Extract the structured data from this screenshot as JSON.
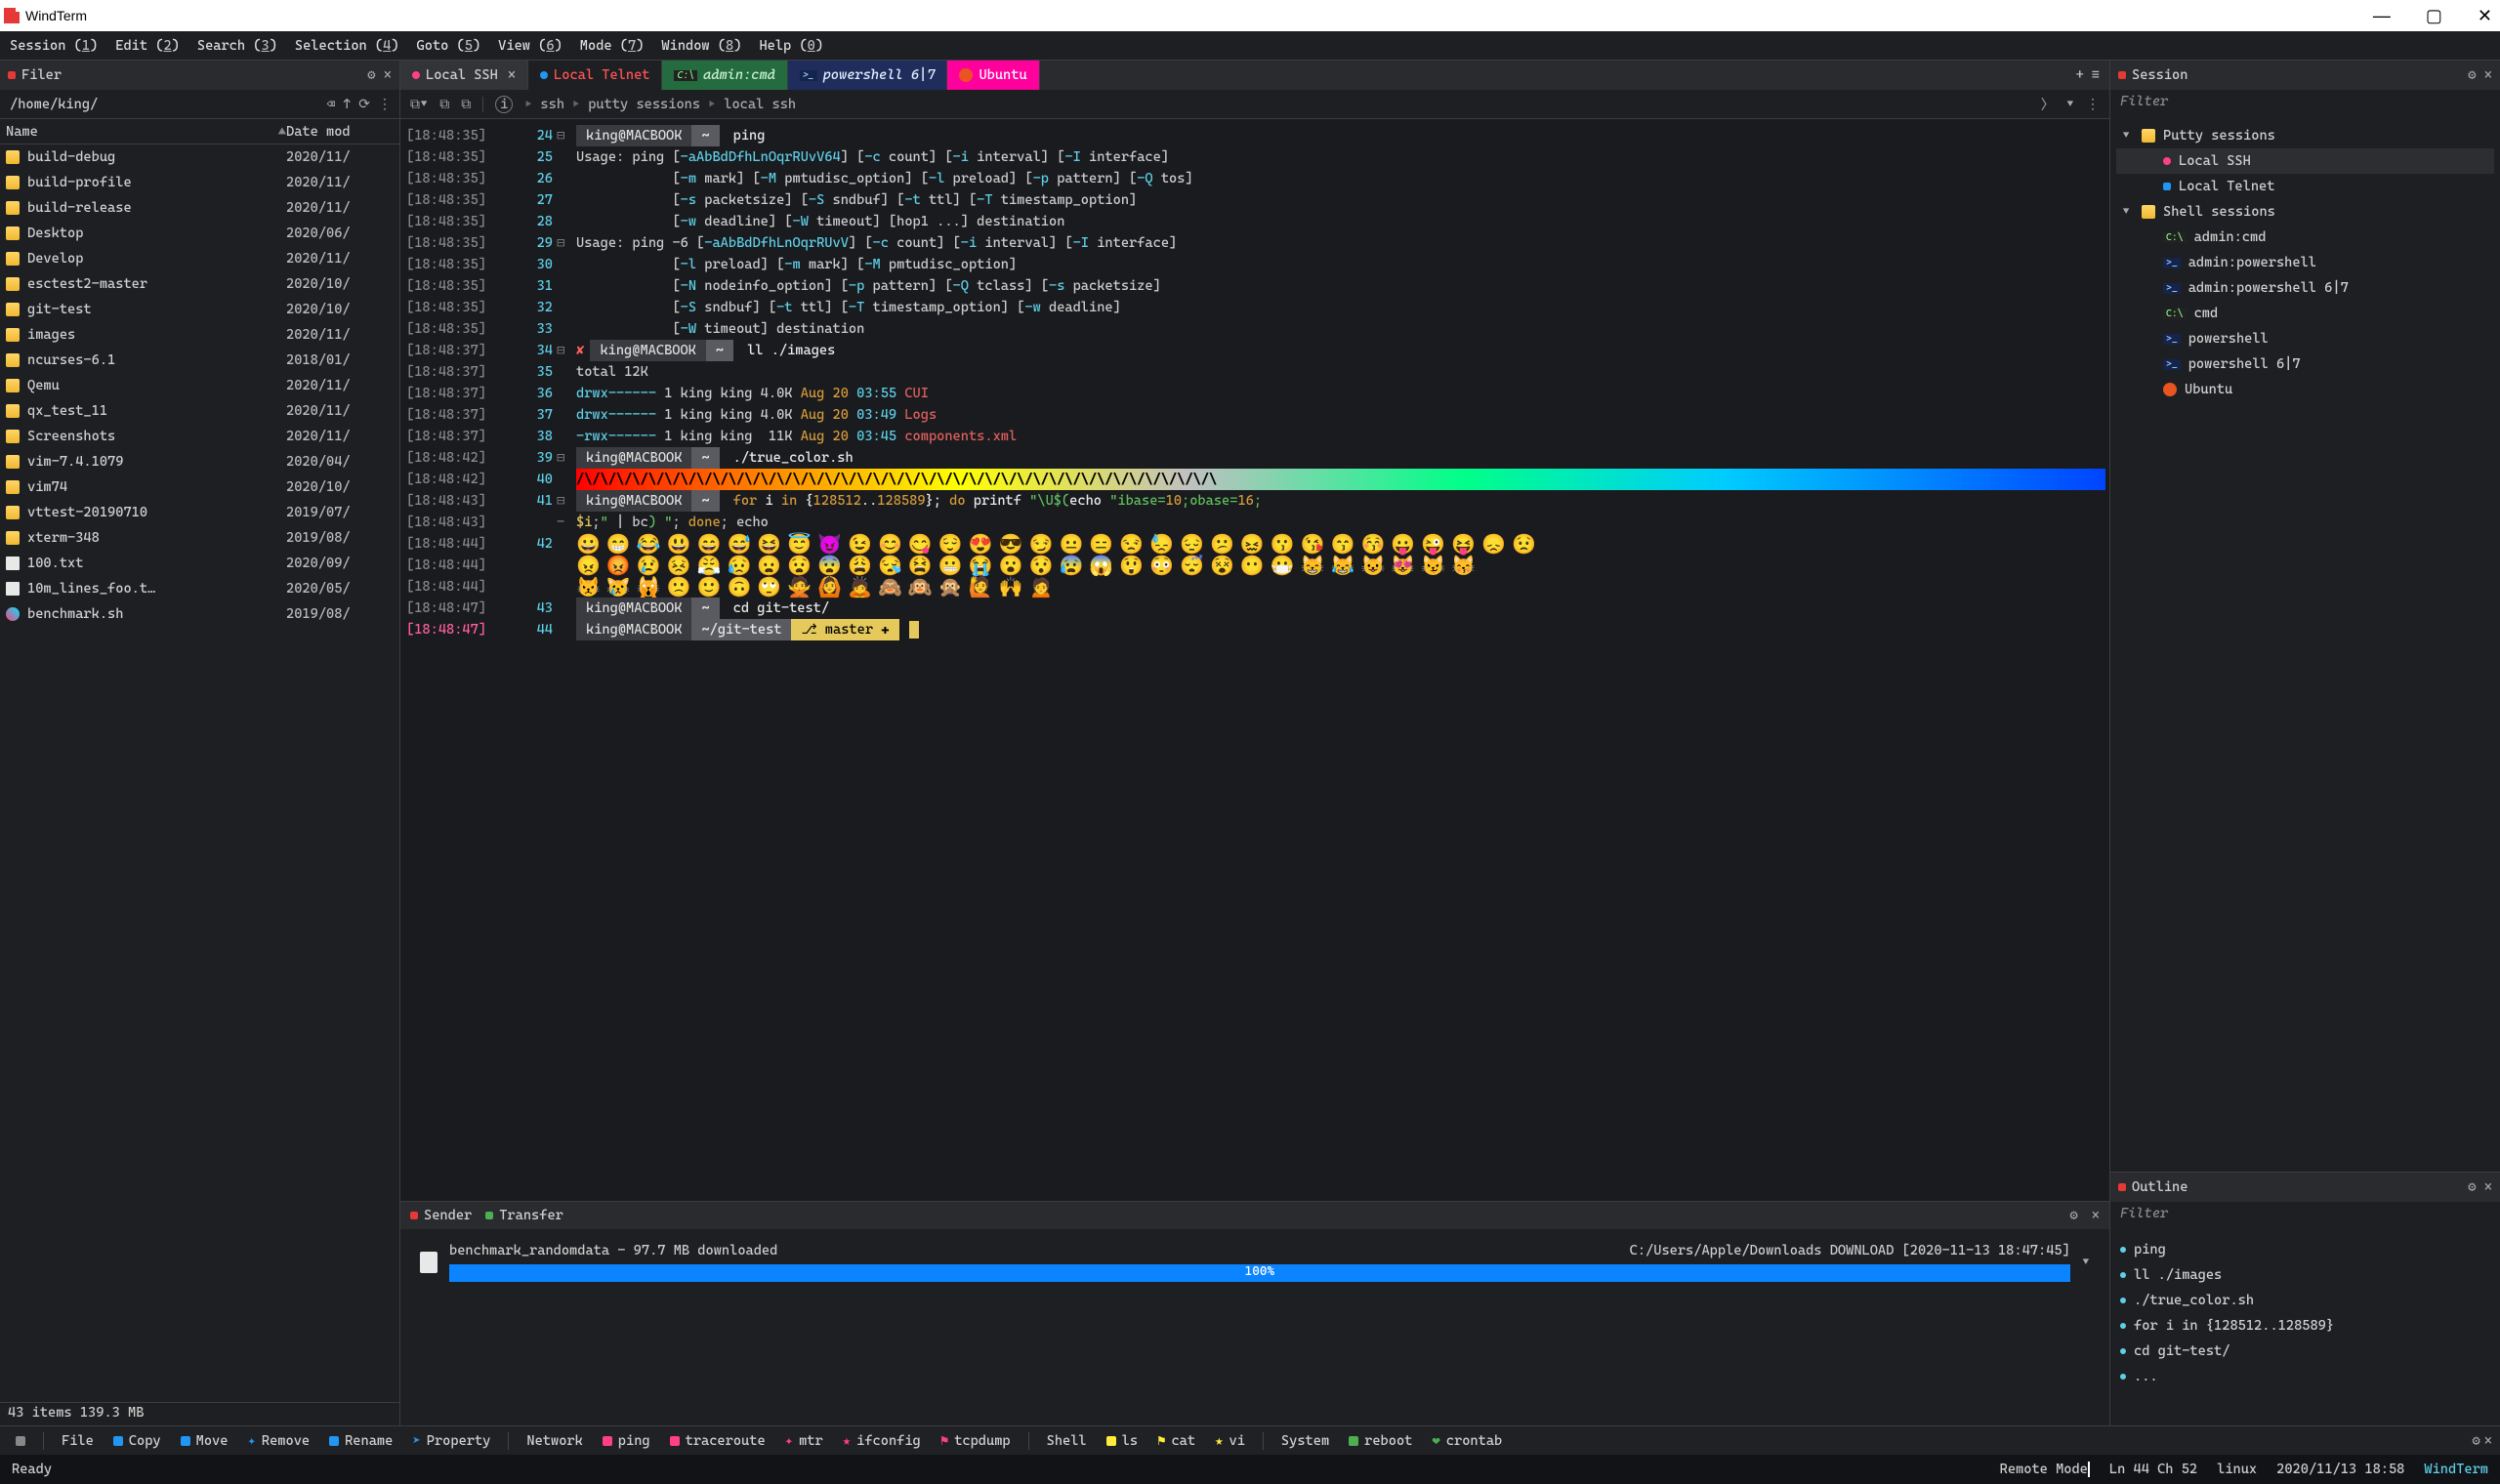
{
  "app": {
    "title": "WindTerm"
  },
  "menu": [
    {
      "label": "Session",
      "key": "1"
    },
    {
      "label": "Edit",
      "key": "2"
    },
    {
      "label": "Search",
      "key": "3"
    },
    {
      "label": "Selection",
      "key": "4"
    },
    {
      "label": "Goto",
      "key": "5"
    },
    {
      "label": "View",
      "key": "6"
    },
    {
      "label": "Mode",
      "key": "7"
    },
    {
      "label": "Window",
      "key": "8"
    },
    {
      "label": "Help",
      "key": "0"
    }
  ],
  "filer": {
    "title": "Filer",
    "path": "/home/king/",
    "columns": [
      "Name",
      "Date mod"
    ],
    "rows": [
      {
        "icon": "folder",
        "name": "build-debug",
        "date": "2020/11/"
      },
      {
        "icon": "folder",
        "name": "build-profile",
        "date": "2020/11/"
      },
      {
        "icon": "folder",
        "name": "build-release",
        "date": "2020/11/"
      },
      {
        "icon": "folder",
        "name": "Desktop",
        "date": "2020/06/"
      },
      {
        "icon": "folder",
        "name": "Develop",
        "date": "2020/11/"
      },
      {
        "icon": "folder",
        "name": "esctest2-master",
        "date": "2020/10/"
      },
      {
        "icon": "folder",
        "name": "git-test",
        "date": "2020/10/"
      },
      {
        "icon": "folder",
        "name": "images",
        "date": "2020/11/"
      },
      {
        "icon": "folder",
        "name": "ncurses-6.1",
        "date": "2018/01/"
      },
      {
        "icon": "folder",
        "name": "Qemu",
        "date": "2020/11/"
      },
      {
        "icon": "folder",
        "name": "qx_test_11",
        "date": "2020/11/"
      },
      {
        "icon": "folder",
        "name": "Screenshots",
        "date": "2020/11/"
      },
      {
        "icon": "folder",
        "name": "vim-7.4.1079",
        "date": "2020/04/"
      },
      {
        "icon": "folder",
        "name": "vim74",
        "date": "2020/10/"
      },
      {
        "icon": "folder",
        "name": "vttest-20190710",
        "date": "2019/07/"
      },
      {
        "icon": "folder",
        "name": "xterm-348",
        "date": "2019/08/"
      },
      {
        "icon": "file",
        "name": "100.txt",
        "date": "2020/09/"
      },
      {
        "icon": "file",
        "name": "10m_lines_foo.t…",
        "date": "2020/05/"
      },
      {
        "icon": "shell",
        "name": "benchmark.sh",
        "date": "2019/08/"
      }
    ],
    "status": "43 items 139.3 MB"
  },
  "tabs": [
    {
      "kind": "local",
      "label": "Local SSH",
      "active": true,
      "closable": true
    },
    {
      "kind": "telnet",
      "label": "Local Telnet"
    },
    {
      "kind": "cmd",
      "label": "admin:cmd"
    },
    {
      "kind": "ps",
      "label": "powershell 6|7"
    },
    {
      "kind": "ubuntu",
      "label": "Ubuntu"
    }
  ],
  "breadcrumb": [
    "ssh",
    "putty sessions",
    "local ssh"
  ],
  "term": {
    "timestamps": [
      "[18:48:35]",
      "[18:48:35]",
      "[18:48:35]",
      "[18:48:35]",
      "[18:48:35]",
      "[18:48:35]",
      "[18:48:35]",
      "[18:48:35]",
      "[18:48:35]",
      "[18:48:35]",
      "[18:48:37]",
      "[18:48:37]",
      "[18:48:37]",
      "[18:48:37]",
      "[18:48:37]",
      "[18:48:42]",
      "[18:48:42]",
      "[18:48:43]",
      "[18:48:43]",
      "[18:48:44]",
      "[18:48:44]",
      "[18:48:44]",
      "[18:48:47]",
      "[18:48:47]"
    ],
    "linenos": [
      "24",
      "25",
      "26",
      "27",
      "28",
      "29",
      "30",
      "31",
      "32",
      "33",
      "34",
      "35",
      "36",
      "37",
      "38",
      "39",
      "40",
      "41",
      "",
      "42",
      "",
      "",
      "43",
      "44"
    ],
    "gutter": [
      "⊟",
      "",
      "",
      "",
      "",
      "⊟",
      "",
      "",
      "",
      "",
      "⊟",
      "",
      "",
      "",
      "",
      "⊟",
      "",
      "⊟",
      "-",
      "",
      "",
      "",
      "",
      ""
    ],
    "current_ts_index": 23,
    "prompts": {
      "host": "king@MACBOOK",
      "dir": "~",
      "gitdir": "~/git-test",
      "branch": "master"
    },
    "cmds": {
      "ping": "ping",
      "ll": "ll ./images",
      "tc": "./true_color.sh",
      "loop": "for i in {128512..128589}; do printf \"\\U$(echo \"ibase=10;obase=16;$i;\" | bc) \"; done; echo",
      "cd": "cd git-test/"
    },
    "usage1": "Usage: ping [-aAbBdDfhLnOqrRUvV64] [-c count] [-i interval] [-I interface]",
    "usage1b": "            [-m mark] [-M pmtudisc_option] [-l preload] [-p pattern] [-Q tos]",
    "usage1c": "            [-s packetsize] [-S sndbuf] [-t ttl] [-T timestamp_option]",
    "usage1d": "            [-w deadline] [-W timeout] [hop1 ...] destination",
    "usage2": "Usage: ping -6 [-aAbBdDfhLnOqrRUvV] [-c count] [-i interval] [-I interface]",
    "usage2b": "            [-l preload] [-m mark] [-M pmtudisc_option]",
    "usage2c": "            [-N nodeinfo_option] [-p pattern] [-Q tclass] [-s packetsize]",
    "usage2d": "            [-S sndbuf] [-t ttl] [-T timestamp_option] [-w deadline]",
    "usage2e": "            [-W timeout] destination",
    "lltotal": "total 12K",
    "ls": [
      {
        "perm": "drwx------",
        "n": "1",
        "u": "king king",
        "sz": "4.0K",
        "dm": "Aug 20",
        "tm": "03:55",
        "nm": "CUI"
      },
      {
        "perm": "drwx------",
        "n": "1",
        "u": "king king",
        "sz": "4.0K",
        "dm": "Aug 20",
        "tm": "03:49",
        "nm": "Logs"
      },
      {
        "perm": "-rwx------",
        "n": "1",
        "u": "king king",
        "sz": " 11K",
        "dm": "Aug 20",
        "tm": "03:45",
        "nm": "components.xml"
      }
    ],
    "rainbow": "/\\/\\/\\/\\/\\/\\/\\/\\/\\/\\/\\/\\/\\/\\/\\/\\/\\/\\/\\/\\/\\/\\/\\/\\/\\/\\/\\/\\/\\/\\/\\/\\/\\/\\/\\/\\/\\/\\/\\/\\",
    "emoji1": "😀😁😂😃😄😅😆😇😈😉😊😋😌😍😎😏😐😑😒😓😔😕😖😗😘😙😚😛😜😝😞😟",
    "emoji2": "😠😡😢😣😤😥😦😧😨😩😪😫😬😭😮😯😰😱😲😳😴😵😶😷😸😹😺😻😼😽",
    "emoji3": "😾😿🙀🙁🙂🙃🙄🙅🙆🙇🙈🙉🙊🙋🙌🙍"
  },
  "session": {
    "title": "Session",
    "filter": "Filter",
    "groups": [
      {
        "name": "Putty sessions",
        "items": [
          {
            "icon": "p",
            "label": "Local SSH",
            "sel": true
          },
          {
            "icon": "b",
            "label": "Local Telnet"
          }
        ]
      },
      {
        "name": "Shell sessions",
        "items": [
          {
            "icon": "cmd",
            "label": "admin:cmd"
          },
          {
            "icon": "ps",
            "label": "admin:powershell"
          },
          {
            "icon": "ps",
            "label": "admin:powershell 6|7"
          },
          {
            "icon": "cmd",
            "label": "cmd"
          },
          {
            "icon": "ps",
            "label": "powershell"
          },
          {
            "icon": "ps",
            "label": "powershell 6|7"
          },
          {
            "icon": "ubuntu",
            "label": "Ubuntu"
          }
        ]
      }
    ]
  },
  "outline": {
    "title": "Outline",
    "filter": "Filter",
    "items": [
      "ping",
      "ll ./images",
      "./true_color.sh",
      "for i in {128512..128589}",
      "cd git-test/",
      "..."
    ]
  },
  "transfer": {
    "tabs": [
      "Sender",
      "Transfer"
    ],
    "file": "benchmark_randomdata - 97.7 MB downloaded",
    "dest": "C:/Users/Apple/Downloads DOWNLOAD [2020-11-13 18:47:45]",
    "pct": "100%"
  },
  "toolbar": {
    "buf": "",
    "file": "File",
    "copy": "Copy",
    "move": "Move",
    "remove": "Remove",
    "rename": "Rename",
    "property": "Property",
    "network": "Network",
    "ping": "ping",
    "traceroute": "traceroute",
    "mtr": "mtr",
    "ifconfig": "ifconfig",
    "tcpdump": "tcpdump",
    "shell": "Shell",
    "ls": "ls",
    "cat": "cat",
    "vi": "vi",
    "system": "System",
    "reboot": "reboot",
    "crontab": "crontab"
  },
  "status": {
    "left": "Ready",
    "mode": "Remote Mode",
    "pos": "Ln 44 Ch 52",
    "os": "linux",
    "time": "2020/11/13 18:58",
    "brand": "WindTerm"
  }
}
